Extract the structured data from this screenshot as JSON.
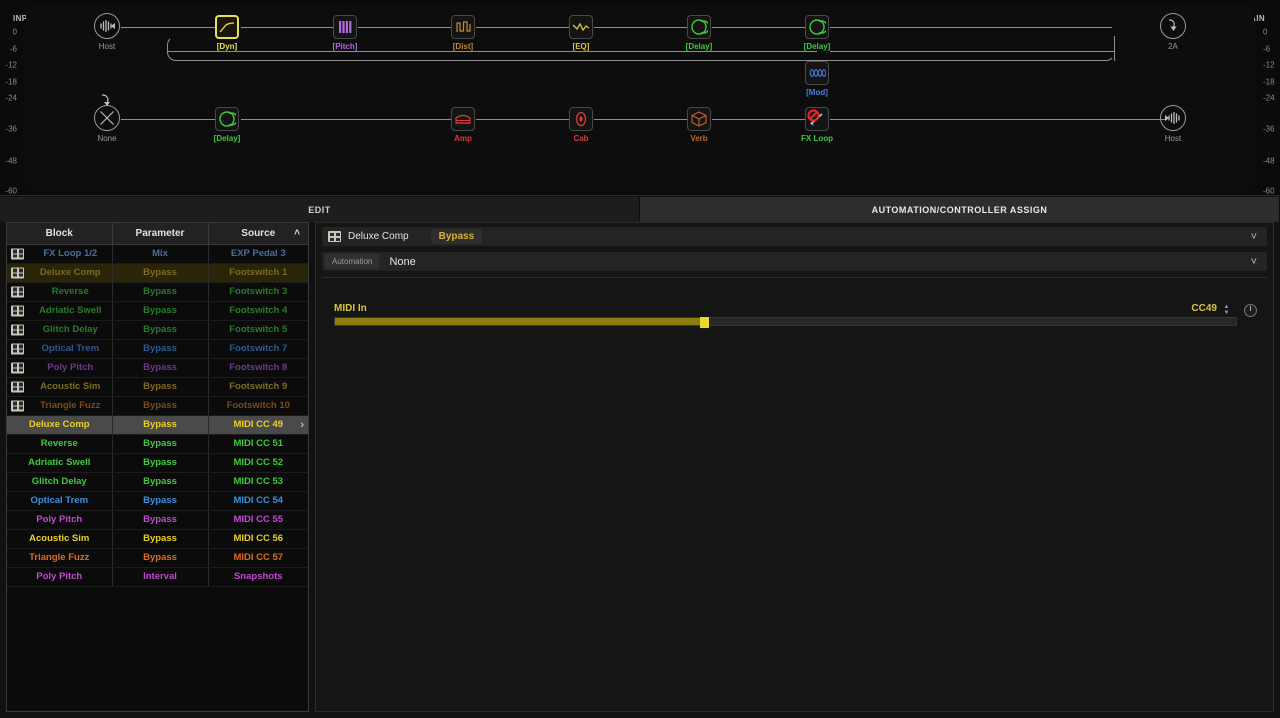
{
  "meters": {
    "input": {
      "title": "INPUT",
      "ticks": [
        "0",
        "-6",
        "-12",
        "-18",
        "-24",
        "-36",
        "-48",
        "-60"
      ]
    },
    "main": {
      "title": "MAIN",
      "ticks": [
        "0",
        "-6",
        "-12",
        "-18",
        "-24",
        "-36",
        "-48",
        "-60"
      ]
    }
  },
  "signal_flow": {
    "input_node": {
      "label": "Host",
      "icon": "waveform-icon"
    },
    "input_node_2": {
      "label": "None",
      "icon": "no-input-icon"
    },
    "output_node": {
      "label": "2A",
      "icon": "output-arrow-icon"
    },
    "output_node_2": {
      "label": "Host",
      "icon": "waveform-icon"
    },
    "blocks_row1": [
      {
        "label": "[Dyn]",
        "color": "#e6e05a",
        "icon": "compressor-curve-icon",
        "selected": true
      },
      {
        "label": "[Pitch]",
        "color": "#b06ae0",
        "icon": "pitch-bars-icon",
        "selected": false
      },
      {
        "label": "[Dist]",
        "color": "#c08a30",
        "icon": "distortion-wave-icon",
        "selected": false
      },
      {
        "label": "[EQ]",
        "color": "#d8c83a",
        "icon": "eq-curve-icon",
        "selected": false
      },
      {
        "label": "[Delay]",
        "color": "#3ec93e",
        "icon": "delay-circle-icon",
        "selected": false
      },
      {
        "label": "[Delay]",
        "color": "#3ec93e",
        "icon": "delay-circle-icon",
        "selected": false
      }
    ],
    "blocks_row_mod": [
      {
        "label": "[Mod]",
        "color": "#4a7fe0",
        "icon": "modulation-sine-icon",
        "selected": false
      }
    ],
    "blocks_row2": [
      {
        "label": "[Delay]",
        "color": "#3ec93e",
        "icon": "delay-circle-icon",
        "selected": false
      },
      {
        "label": "Amp",
        "color": "#e03a3a",
        "icon": "amp-icon",
        "selected": false
      },
      {
        "label": "Cab",
        "color": "#e03a3a",
        "icon": "cabinet-icon",
        "selected": false
      },
      {
        "label": "Verb",
        "color": "#c0642a",
        "icon": "reverb-cube-icon",
        "selected": false
      },
      {
        "label": "FX Loop",
        "color": "#3ec93e",
        "icon": "fx-loop-bypassed-icon",
        "selected": false
      }
    ]
  },
  "tabs": [
    {
      "label": "EDIT",
      "active": false
    },
    {
      "label": "AUTOMATION/CONTROLLER ASSIGN",
      "active": true
    }
  ],
  "table": {
    "headers": [
      "Block",
      "Parameter",
      "Source"
    ],
    "sort_indicator": "˄",
    "rows": [
      {
        "block": "FX Loop 1/2",
        "parameter": "Mix",
        "source": "EXP Pedal 3",
        "color": "#4a6e9c",
        "icon": true,
        "state": "dim"
      },
      {
        "block": "Deluxe Comp",
        "parameter": "Bypass",
        "source": "Footswitch 1",
        "color": "#7d6b1e",
        "icon": true,
        "state": "amber"
      },
      {
        "block": "Reverse",
        "parameter": "Bypass",
        "source": "Footswitch 3",
        "color": "#2a7a2a",
        "icon": true,
        "state": "dim"
      },
      {
        "block": "Adriatic Swell",
        "parameter": "Bypass",
        "source": "Footswitch 4",
        "color": "#2a7a2a",
        "icon": true,
        "state": "dim"
      },
      {
        "block": "Glitch Delay",
        "parameter": "Bypass",
        "source": "Footswitch 5",
        "color": "#2a7a2a",
        "icon": true,
        "state": "dim"
      },
      {
        "block": "Optical Trem",
        "parameter": "Bypass",
        "source": "Footswitch 7",
        "color": "#2c5a8c",
        "icon": true,
        "state": "dim"
      },
      {
        "block": "Poly Pitch",
        "parameter": "Bypass",
        "source": "Footswitch 8",
        "color": "#6b3a8c",
        "icon": true,
        "state": "dim"
      },
      {
        "block": "Acoustic Sim",
        "parameter": "Bypass",
        "source": "Footswitch 9",
        "color": "#7d6b1e",
        "icon": true,
        "state": "dim"
      },
      {
        "block": "Triangle Fuzz",
        "parameter": "Bypass",
        "source": "Footswitch 10",
        "color": "#7a4a1e",
        "icon": true,
        "state": "dim"
      },
      {
        "block": "Deluxe Comp",
        "parameter": "Bypass",
        "source": "MIDI CC 49",
        "color": "#e8d028",
        "icon": false,
        "state": "selected"
      },
      {
        "block": "Reverse",
        "parameter": "Bypass",
        "source": "MIDI CC 51",
        "color": "#3ec93e",
        "icon": false,
        "state": "normal"
      },
      {
        "block": "Adriatic Swell",
        "parameter": "Bypass",
        "source": "MIDI CC 52",
        "color": "#3ec93e",
        "icon": false,
        "state": "normal"
      },
      {
        "block": "Glitch Delay",
        "parameter": "Bypass",
        "source": "MIDI CC 53",
        "color": "#3ec93e",
        "icon": false,
        "state": "normal"
      },
      {
        "block": "Optical Trem",
        "parameter": "Bypass",
        "source": "MIDI CC 54",
        "color": "#3d8fe0",
        "icon": false,
        "state": "normal"
      },
      {
        "block": "Poly Pitch",
        "parameter": "Bypass",
        "source": "MIDI CC 55",
        "color": "#c04ad0",
        "icon": false,
        "state": "normal"
      },
      {
        "block": "Acoustic Sim",
        "parameter": "Bypass",
        "source": "MIDI CC 56",
        "color": "#e8d028",
        "icon": false,
        "state": "normal"
      },
      {
        "block": "Triangle Fuzz",
        "parameter": "Bypass",
        "source": "MIDI CC 57",
        "color": "#e06a1e",
        "icon": false,
        "state": "normal"
      },
      {
        "block": "Poly Pitch",
        "parameter": "Interval",
        "source": "Snapshots",
        "color": "#c04ad0",
        "icon": false,
        "state": "normal"
      }
    ],
    "selected_row_chevron": "›"
  },
  "detail": {
    "block_name": "Deluxe Comp",
    "parameter": "Bypass",
    "automation_label": "Automation",
    "automation_value": "None",
    "dropdown_caret": "˅",
    "midi_in_label": "MIDI In",
    "cc_value": "CC49",
    "spinner_up": "▲",
    "spinner_down": "▼",
    "slider_percent": 41
  },
  "colors": {
    "accent_yellow": "#e8d028",
    "green": "#3ec93e",
    "red": "#e03a3a",
    "panel_bg": "#151515"
  }
}
